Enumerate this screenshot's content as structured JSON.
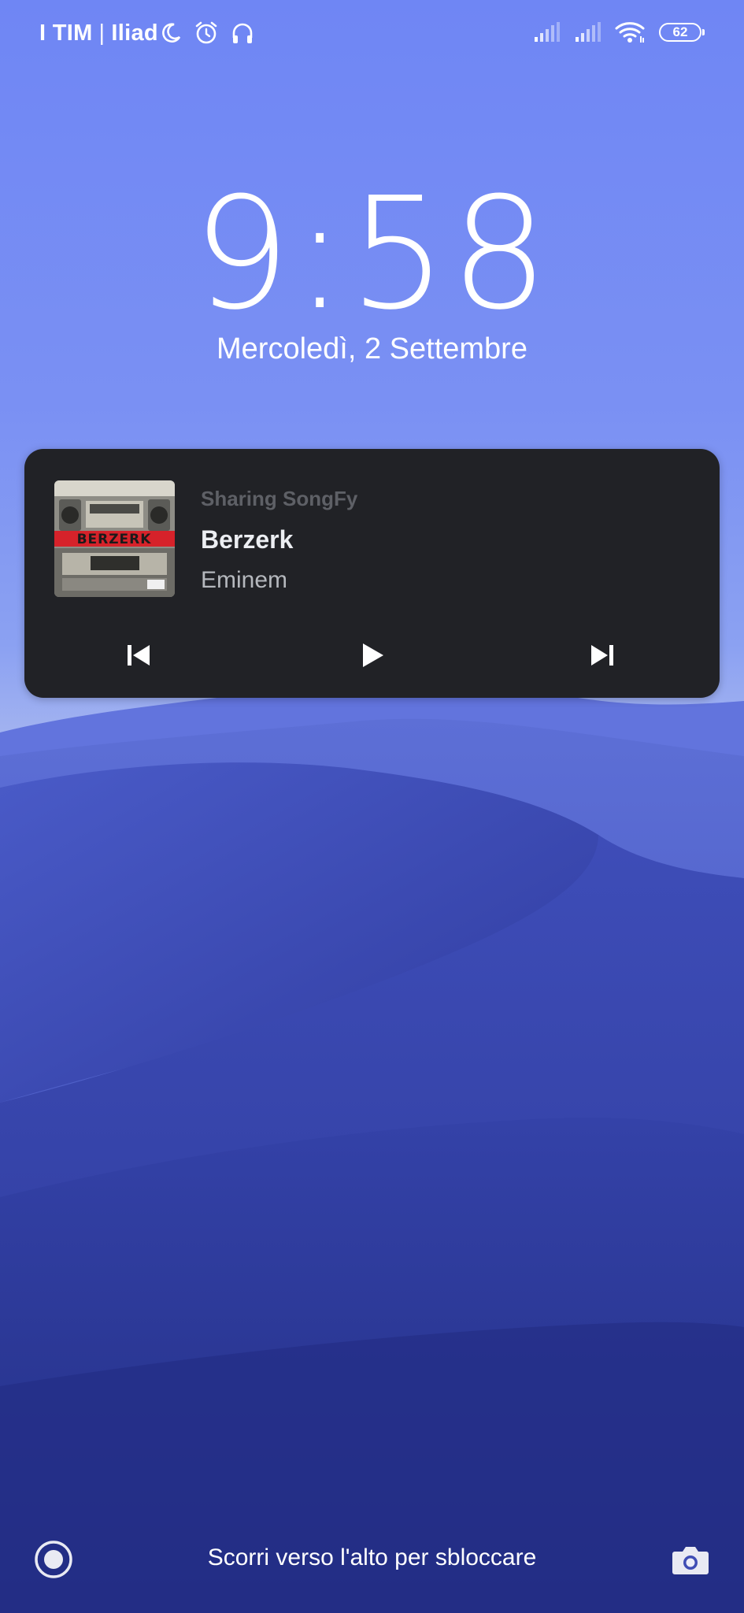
{
  "status_bar": {
    "carrier_1": "I TIM",
    "separator": "|",
    "carrier_2": "Iliad",
    "left_icons": [
      "moon-icon",
      "alarm-icon",
      "headphones-icon"
    ],
    "right_icons": [
      "signal-icon",
      "signal-icon",
      "wifi-icon"
    ],
    "battery_level": "62"
  },
  "lock_screen": {
    "time": "9:58",
    "date": "Mercoledì, 2 Settembre"
  },
  "media_player": {
    "app_name": "Sharing SongFy",
    "title": "Berzerk",
    "artist": "Eminem",
    "album_art_text": "BERZERK",
    "controls": [
      "previous-icon",
      "play-icon",
      "next-icon"
    ]
  },
  "bottom_bar": {
    "unlock_hint": "Scorri verso l'alto per sbloccare",
    "left_icon": "assistant-icon",
    "right_icon": "camera-icon"
  },
  "colors": {
    "sky_top": "#6f86f4",
    "dune_dark": "#2c399a",
    "card_bg": "#212226",
    "accent_red": "#d6222a"
  }
}
